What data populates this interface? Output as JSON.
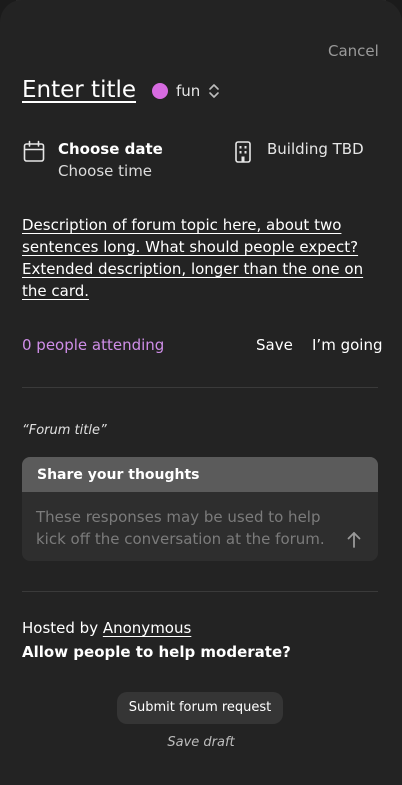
{
  "header": {
    "cancel_label": "Cancel"
  },
  "event": {
    "title_placeholder": "Enter title",
    "tag": {
      "label": "fun",
      "color": "#d66be0"
    },
    "date_label": "Choose date",
    "time_label": "Choose time",
    "location": "Building TBD",
    "description": "Description of forum topic here, about two sentences long. What should people expect? Extended description, longer than the one on the card."
  },
  "actions": {
    "attending": "0 people attending",
    "attending_color": "#cf8ee8",
    "save": "Save",
    "going": "I’m going"
  },
  "forum": {
    "title": "“Forum title”",
    "thoughts_header": "Share your thoughts",
    "thoughts_placeholder": "These responses may be used to help kick off the conversation at the forum."
  },
  "host": {
    "prefix": "Hosted by",
    "name": "Anonymous",
    "moderate": "Allow people to help moderate?"
  },
  "footer": {
    "submit": "Submit forum request",
    "draft": "Save draft"
  }
}
